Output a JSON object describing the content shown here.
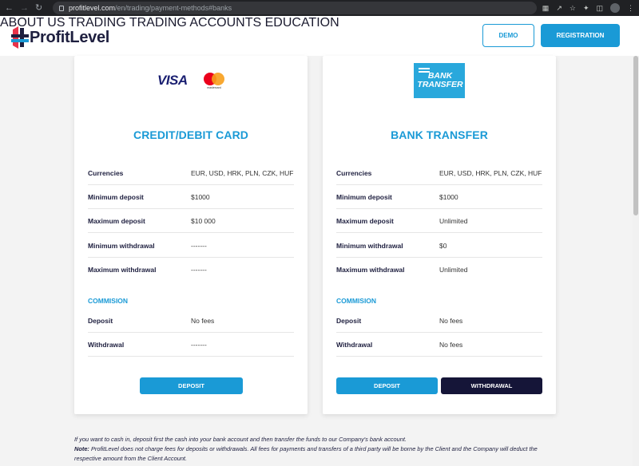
{
  "browser": {
    "url_host": "profitlevel.com",
    "url_path": "/en/trading/payment-methods#banks"
  },
  "header": {
    "logo_text": "ProfitLevel",
    "nav": [
      "ABOUT US",
      "TRADING",
      "TRADING ACCOUNTS",
      "EDUCATION"
    ],
    "demo_label": "DEMO",
    "registration_label": "REGISTRATION"
  },
  "cards": [
    {
      "logo": "VISA",
      "logo_sub": "mastercard",
      "title": "CREDIT/DEBIT CARD",
      "rows": [
        {
          "label": "Currencies",
          "value": "EUR, USD, HRK, PLN, CZK, HUF"
        },
        {
          "label": "Minimum deposit",
          "value": "$1000"
        },
        {
          "label": "Maximum deposit",
          "value": "$10 000"
        },
        {
          "label": "Minimum withdrawal",
          "value": "-------"
        },
        {
          "label": "Maximum withdrawal",
          "value": "-------"
        }
      ],
      "section": "COMMISION",
      "commission": [
        {
          "label": "Deposit",
          "value": "No fees"
        },
        {
          "label": "Withdrawal",
          "value": "-------"
        }
      ],
      "deposit_label": "DEPOSIT"
    },
    {
      "logo": "BANK TRANSFER",
      "title": "BANK TRANSFER",
      "rows": [
        {
          "label": "Currencies",
          "value": "EUR, USD, HRK, PLN, CZK, HUF"
        },
        {
          "label": "Minimum deposit",
          "value": "$1000"
        },
        {
          "label": "Maximum deposit",
          "value": "Unlimited"
        },
        {
          "label": "Minimum withdrawal",
          "value": "$0"
        },
        {
          "label": "Maximum withdrawal",
          "value": "Unlimited"
        }
      ],
      "section": "COMMISION",
      "commission": [
        {
          "label": "Deposit",
          "value": "No fees"
        },
        {
          "label": "Withdrawal",
          "value": "No fees"
        }
      ],
      "deposit_label": "DEPOSIT",
      "withdrawal_label": "WITHDRAWAL"
    }
  ],
  "notes": {
    "line1": "If you want to cash in, deposit first the cash into your bank account and then transfer the funds to our Company's bank account.",
    "note_label": "Note:",
    "line2": "ProfitLevel does not charge fees for deposits or withdrawals. All fees for payments and transfers of a third party will be borne by the Client and the Company will deduct the respective amount from the Client Account."
  },
  "colors": {
    "accent": "#1a9ad6",
    "dark": "#151538",
    "brand_text": "#1e1f3f"
  }
}
